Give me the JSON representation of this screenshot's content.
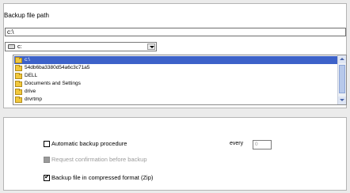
{
  "backup_path": {
    "label": "Backup file path",
    "path_value": "c:\\",
    "drive": "c:",
    "folders": [
      "c:\\",
      "54db6ba3380d54a6c3c71a5",
      "DELL",
      "Documents and Settings",
      "drive",
      "drvrtmp"
    ],
    "selected_index": 0
  },
  "options": {
    "automatic_backup": {
      "label": "Automatic backup procedure",
      "checked": false
    },
    "every_label": "every",
    "every_value": "0",
    "request_confirmation": {
      "label": "Request confirmation before backup",
      "checked": false,
      "disabled": true
    },
    "compressed": {
      "label": "Backup file in compressed format (Zip)",
      "checked": true
    }
  },
  "icons": {
    "drive": "drive-icon",
    "folder": "folder-icon",
    "dropdown": "chevron-down-icon",
    "scroll_up": "arrow-up-icon",
    "scroll_down": "arrow-down-icon"
  },
  "colors": {
    "selection": "#3d62c9",
    "folder": "#f2c83c",
    "disabled_text": "#9a9a9a"
  }
}
